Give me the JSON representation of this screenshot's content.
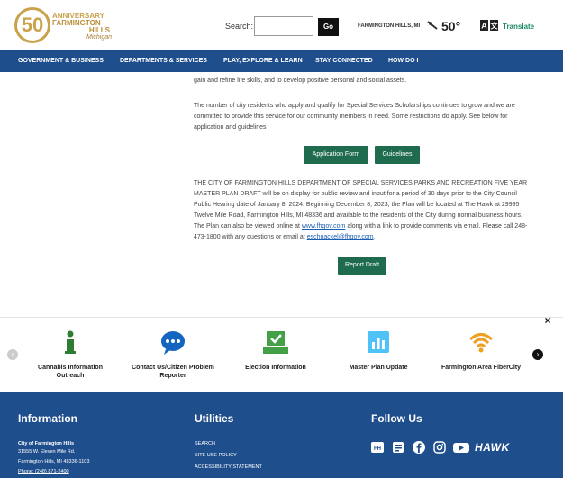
{
  "header": {
    "logo": {
      "number": "50",
      "line1": "ANNIVERSARY",
      "line2": "FARMINGTON",
      "line3": "HILLS",
      "line4": "Michigan"
    },
    "search_label": "Search:",
    "search_placeholder": "",
    "go_label": "Go",
    "weather_city": "FARMINGTON HILLS, MI",
    "weather_temp": "50°",
    "translate_label": "Translate"
  },
  "nav": [
    "GOVERNMENT & BUSINESS",
    "DEPARTMENTS & SERVICES",
    "PLAY, EXPLORE & LEARN",
    "STAY CONNECTED",
    "HOW DO I"
  ],
  "main": {
    "para_top": "gain and refine life skills, and to develop positive personal and social assets.",
    "para_scholar": "The number of city residents who apply and qualify for Special Services Scholarships continues to grow and we are committed to provide this service for our community members in need.  Some restrictions do apply. See below for application and guidelines",
    "application_btn": "Application Form",
    "guidelines_btn": "Guidelines",
    "plan_text": "THE CITY OF FARMINGTON HILLS DEPARTMENT OF SPECIAL SERVICES PARKS AND RECREATION FIVE YEAR MASTER PLAN DRAFT will be on display for public review and input for a period of 30 days prior to the City Council Public Hearing date of January 8, 2024. Beginning December 8, 2023, the Plan will be located at The Hawk at 29995 Twelve Mile Road, Farmington Hills, MI 48336 and available to the residents of the City during normal business hours. The Plan can also be viewed online at",
    "plan_link1": "www.fhgov.com",
    "plan_mid": " along with a link to provide comments via email. Please call 248-473-1800 with any questions or email at",
    "plan_link2": "eschnackel@fhgov.com",
    "plan_end": ".",
    "report_btn": "Report Draft"
  },
  "carousel": {
    "close": "×",
    "items": [
      {
        "label": "Cannabis Information Outreach",
        "icon": "info-icon",
        "color": "#2e7d32"
      },
      {
        "label": "Contact Us/Citizen Problem Reporter",
        "icon": "chat-icon",
        "color": "#1565c0"
      },
      {
        "label": "Election Information",
        "icon": "ballot-icon",
        "color": "#43a047"
      },
      {
        "label": "Master Plan Update",
        "icon": "chart-icon",
        "color": "#4fc3f7"
      },
      {
        "label": "Farmington Area FiberCity",
        "icon": "wifi-icon",
        "color": "#f0a020"
      }
    ]
  },
  "footer": {
    "info_title": "Information",
    "org": "City of Farmington Hills",
    "addr1": "31555 W. Eleven Mile Rd.",
    "addr2": "Farmington Hills, MI 48336-1103",
    "phone": "Phone: (248) 871-2400",
    "util_title": "Utilities",
    "util_links": [
      "SEARCH",
      "SITE USE POLICY",
      "ACCESSIBILITY STATEMENT"
    ],
    "follow_title": "Follow Us",
    "hawk": "HAWK"
  }
}
